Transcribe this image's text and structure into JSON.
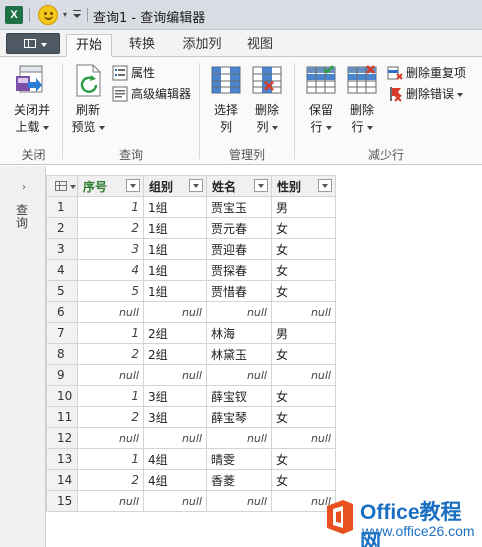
{
  "titlebar": {
    "app_logo": "X",
    "title": "查询1 - 查询编辑器"
  },
  "tabs": [
    {
      "label": "开始",
      "active": true
    },
    {
      "label": "转换",
      "active": false
    },
    {
      "label": "添加列",
      "active": false
    },
    {
      "label": "视图",
      "active": false
    }
  ],
  "ribbon": {
    "close_load_line1": "关闭并",
    "close_load_line2": "上载",
    "refresh_line1": "刷新",
    "refresh_line2": "预览",
    "properties": "属性",
    "advanced_editor": "高级编辑器",
    "choose_cols_line1": "选择",
    "choose_cols_line2": "列",
    "remove_cols_line1": "删除",
    "remove_cols_line2": "列",
    "keep_rows_line1": "保留",
    "keep_rows_line2": "行",
    "remove_rows_line1": "删除",
    "remove_rows_line2": "行",
    "remove_duplicates": "删除重复项",
    "remove_errors": "删除错误",
    "groups": [
      "关闭",
      "查询",
      "管理列",
      "减少行"
    ]
  },
  "query_pane": {
    "label": "查询"
  },
  "grid": {
    "columns": [
      "序号",
      "组别",
      "姓名",
      "性别"
    ],
    "rows": [
      {
        "n": "1",
        "seq": "1",
        "group": "1组",
        "name": "贾宝玉",
        "gender": "男"
      },
      {
        "n": "2",
        "seq": "2",
        "group": "1组",
        "name": "贾元春",
        "gender": "女"
      },
      {
        "n": "3",
        "seq": "3",
        "group": "1组",
        "name": "贾迎春",
        "gender": "女"
      },
      {
        "n": "4",
        "seq": "4",
        "group": "1组",
        "name": "贾探春",
        "gender": "女"
      },
      {
        "n": "5",
        "seq": "5",
        "group": "1组",
        "name": "贾惜春",
        "gender": "女"
      },
      {
        "n": "6",
        "seq": "null",
        "group": "null",
        "name": "null",
        "gender": "null"
      },
      {
        "n": "7",
        "seq": "1",
        "group": "2组",
        "name": "林海",
        "gender": "男"
      },
      {
        "n": "8",
        "seq": "2",
        "group": "2组",
        "name": "林黛玉",
        "gender": "女"
      },
      {
        "n": "9",
        "seq": "null",
        "group": "null",
        "name": "null",
        "gender": "null"
      },
      {
        "n": "10",
        "seq": "1",
        "group": "3组",
        "name": "薛宝钗",
        "gender": "女"
      },
      {
        "n": "11",
        "seq": "2",
        "group": "3组",
        "name": "薛宝琴",
        "gender": "女"
      },
      {
        "n": "12",
        "seq": "null",
        "group": "null",
        "name": "null",
        "gender": "null"
      },
      {
        "n": "13",
        "seq": "1",
        "group": "4组",
        "name": "晴雯",
        "gender": "女"
      },
      {
        "n": "14",
        "seq": "2",
        "group": "4组",
        "name": "香菱",
        "gender": "女"
      },
      {
        "n": "15",
        "seq": "null",
        "group": "null",
        "name": "null",
        "gender": "null"
      }
    ]
  },
  "watermark": {
    "title": "Office教程网",
    "url": "www.office26.com"
  }
}
